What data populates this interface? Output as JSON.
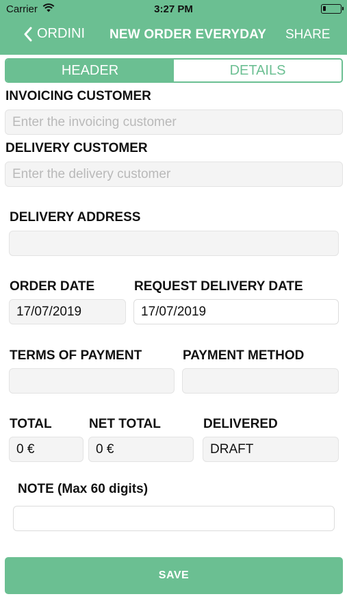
{
  "status_bar": {
    "carrier": "Carrier",
    "time": "3:27 PM"
  },
  "nav": {
    "back_label": "ORDINI",
    "title": "NEW ORDER EVERYDAY",
    "share_label": "SHARE"
  },
  "tabs": [
    {
      "label": "HEADER",
      "active": true
    },
    {
      "label": "DETAILS",
      "active": false
    }
  ],
  "form": {
    "invoicing_customer": {
      "label": "INVOICING CUSTOMER",
      "placeholder": "Enter the invoicing customer",
      "value": ""
    },
    "delivery_customer": {
      "label": "DELIVERY CUSTOMER",
      "placeholder": "Enter the delivery customer",
      "value": ""
    },
    "delivery_address": {
      "label": "DELIVERY ADDRESS",
      "value": ""
    },
    "order_date": {
      "label": "ORDER DATE",
      "value": "17/07/2019"
    },
    "request_delivery_date": {
      "label": "REQUEST DELIVERY DATE",
      "value": "17/07/2019"
    },
    "terms_of_payment": {
      "label": "TERMS OF PAYMENT",
      "value": ""
    },
    "payment_method": {
      "label": "PAYMENT METHOD",
      "value": ""
    },
    "total": {
      "label": "TOTAL",
      "value": "0 €"
    },
    "net_total": {
      "label": "NET TOTAL",
      "value": "0 €"
    },
    "delivered": {
      "label": "DELIVERED",
      "value": "DRAFT"
    },
    "note": {
      "label": "NOTE (Max 60 digits)",
      "value": ""
    }
  },
  "save_label": "SAVE",
  "colors": {
    "accent": "#6bbf92",
    "field_bg": "#f4f4f4",
    "placeholder": "#b9b9b9"
  },
  "icons": {
    "back": "chevron-left-icon",
    "wifi": "wifi-icon",
    "battery": "battery-icon"
  }
}
